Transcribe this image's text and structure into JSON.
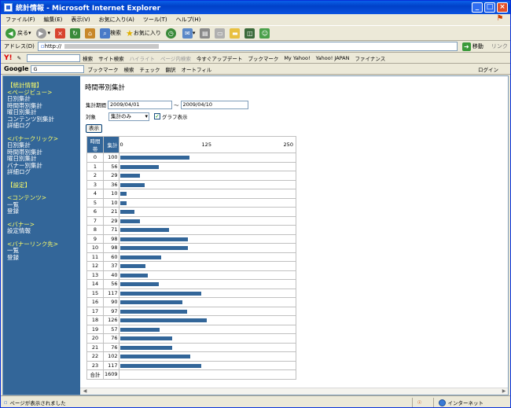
{
  "window": {
    "title": "統計情報 - Microsoft Internet Explorer"
  },
  "menu": [
    "ファイル(F)",
    "編集(E)",
    "表示(V)",
    "お気に入り(A)",
    "ツール(T)",
    "ヘルプ(H)"
  ],
  "toolbar": {
    "back_label": "戻る",
    "search_label": "検索",
    "favorites_label": "お気に入り"
  },
  "address": {
    "label": "アドレス(D)",
    "value": "http://",
    "go_label": "移動",
    "links_label": "リンク"
  },
  "yahoo_bar": {
    "logo": "Y!",
    "search_label": "検索",
    "items": [
      "サイト検索",
      "ハイライト",
      "ページ内検索",
      "今すぐアップデート",
      "ブックマーク",
      "My Yahoo!",
      "Yahoo! JAPAN",
      "ファイナンス"
    ]
  },
  "google_bar": {
    "logo": "Google",
    "input_value": "G",
    "items": [
      "ブックマーク",
      "検索",
      "チェック",
      "翻訳",
      "オートフィル"
    ],
    "login_label": "ログイン"
  },
  "sidebar": {
    "sections": [
      {
        "head": "【統計情報】"
      },
      {
        "head": "<ページビュー>",
        "links": [
          "日別集計",
          "時間帯別集計",
          "曜日別集計",
          "コンテンツ別集計",
          "詳細ログ"
        ]
      },
      {
        "head": "<バナークリック>",
        "links": [
          "日別集計",
          "時間帯別集計",
          "曜日別集計",
          "バナー別集計",
          "詳細ログ"
        ]
      },
      {
        "head": "【設定】"
      },
      {
        "head": "<コンテンツ>",
        "links": [
          "一覧",
          "登録"
        ]
      },
      {
        "head": "<バナー>",
        "links": [
          "設定情報"
        ]
      },
      {
        "head": "<バナーリンク先>",
        "links": [
          "一覧",
          "登録"
        ]
      }
    ]
  },
  "main": {
    "title": "時間帯別集計",
    "period_label": "集計期間",
    "date_from": "2009/04/01",
    "tilde": "～",
    "date_to": "2009/04/10",
    "target_label": "対象",
    "target_value": "集計のみ",
    "graph_label": "グラフ表示",
    "graph_checked": true,
    "show_button": "表示"
  },
  "table": {
    "headers": [
      "時間帯",
      "集計"
    ],
    "scale_ticks": [
      "0",
      "125",
      "250"
    ],
    "rows": [
      {
        "hour": "0",
        "count": "100"
      },
      {
        "hour": "1",
        "count": "56"
      },
      {
        "hour": "2",
        "count": "29"
      },
      {
        "hour": "3",
        "count": "36"
      },
      {
        "hour": "4",
        "count": "10"
      },
      {
        "hour": "5",
        "count": "10"
      },
      {
        "hour": "6",
        "count": "21"
      },
      {
        "hour": "7",
        "count": "29"
      },
      {
        "hour": "8",
        "count": "71"
      },
      {
        "hour": "9",
        "count": "98"
      },
      {
        "hour": "10",
        "count": "98"
      },
      {
        "hour": "11",
        "count": "60"
      },
      {
        "hour": "12",
        "count": "37"
      },
      {
        "hour": "13",
        "count": "40"
      },
      {
        "hour": "14",
        "count": "56"
      },
      {
        "hour": "15",
        "count": "117"
      },
      {
        "hour": "16",
        "count": "90"
      },
      {
        "hour": "17",
        "count": "97"
      },
      {
        "hour": "18",
        "count": "126"
      },
      {
        "hour": "19",
        "count": "57"
      },
      {
        "hour": "20",
        "count": "76"
      },
      {
        "hour": "21",
        "count": "76"
      },
      {
        "hour": "22",
        "count": "102"
      },
      {
        "hour": "23",
        "count": "117"
      }
    ],
    "total_label": "合計",
    "total_value": "1609"
  },
  "chart_data": {
    "type": "bar",
    "categories": [
      "0",
      "1",
      "2",
      "3",
      "4",
      "5",
      "6",
      "7",
      "8",
      "9",
      "10",
      "11",
      "12",
      "13",
      "14",
      "15",
      "16",
      "17",
      "18",
      "19",
      "20",
      "21",
      "22",
      "23"
    ],
    "values": [
      100,
      56,
      29,
      36,
      10,
      10,
      21,
      29,
      71,
      98,
      98,
      60,
      37,
      40,
      56,
      117,
      90,
      97,
      126,
      57,
      76,
      76,
      102,
      117
    ],
    "xlim": [
      0,
      250
    ],
    "orientation": "horizontal",
    "bar_color": "#336699"
  },
  "status": {
    "text": "ページが表示されました",
    "zone": "インターネット"
  },
  "colors": {
    "sidebar_bg": "#336699",
    "sidebar_head": "#ffff66",
    "bar": "#336699"
  }
}
